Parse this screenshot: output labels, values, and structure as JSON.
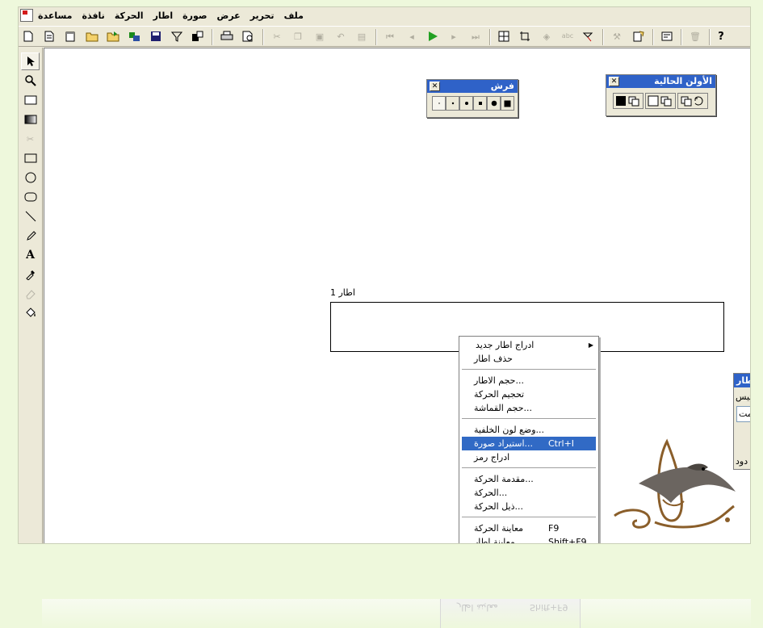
{
  "menubar": {
    "items": [
      "ملف",
      "تحرير",
      "عرض",
      "صورة",
      "اطار",
      "الحركة",
      "نافذة",
      "مساعدة"
    ]
  },
  "toolbar": {
    "buttons": [
      {
        "icon": "new-icon"
      },
      {
        "icon": "new-template-icon"
      },
      {
        "icon": "new-blank-icon"
      },
      {
        "icon": "open-icon"
      },
      {
        "icon": "open-folder-icon"
      },
      {
        "icon": "import-icon"
      },
      {
        "icon": "save-icon"
      },
      {
        "icon": "filter-icon"
      },
      {
        "icon": "export-icon"
      },
      {
        "icon": "print-icon"
      },
      {
        "icon": "print-preview-icon"
      },
      {
        "icon": "cut-icon"
      },
      {
        "icon": "copy-icon"
      },
      {
        "icon": "paste-icon"
      },
      {
        "icon": "undo-icon"
      },
      {
        "icon": "frame-icon"
      },
      {
        "icon": "first-frame-icon"
      },
      {
        "icon": "prev-frame-icon"
      },
      {
        "icon": "play-icon"
      },
      {
        "icon": "next-frame-icon"
      },
      {
        "icon": "last-frame-icon"
      },
      {
        "icon": "grid-icon"
      },
      {
        "icon": "crop-icon"
      },
      {
        "icon": "layers-icon"
      },
      {
        "icon": "text-effect-icon"
      },
      {
        "icon": "pointer-effect-icon"
      },
      {
        "icon": "tools-icon"
      },
      {
        "icon": "new-page-icon"
      },
      {
        "icon": "settings-icon"
      },
      {
        "icon": "delete-icon"
      },
      {
        "icon": "help-icon"
      }
    ]
  },
  "tools": [
    {
      "icon": "select-arrow-icon"
    },
    {
      "icon": "zoom-icon"
    },
    {
      "icon": "rectangle-select-icon"
    },
    {
      "icon": "gradient-icon"
    },
    {
      "icon": "scissors-icon"
    },
    {
      "icon": "rectangle-icon"
    },
    {
      "icon": "ellipse-icon"
    },
    {
      "icon": "rounded-rect-icon"
    },
    {
      "icon": "line-icon"
    },
    {
      "icon": "pencil-icon"
    },
    {
      "icon": "text-icon"
    },
    {
      "icon": "eyedropper-icon"
    },
    {
      "icon": "eraser-icon"
    },
    {
      "icon": "fill-bucket-icon"
    }
  ],
  "brush_palette": {
    "title": "فرش",
    "close": "✕"
  },
  "color_palette": {
    "title": "الأولن الحالية",
    "close": "✕"
  },
  "frame": {
    "label": "اطار 1"
  },
  "side_panel": {
    "title": "اطار",
    "t1": "تيس",
    "field": "مت",
    "t2": "دود"
  },
  "context_menu": {
    "items": [
      {
        "label": "ادراج اطار جديد",
        "submenu": true
      },
      {
        "label": "حذف اطار"
      },
      {
        "sep": true
      },
      {
        "label": "حجم الاطار..."
      },
      {
        "label": "تحجيم الحركة"
      },
      {
        "label": "حجم القماشة..."
      },
      {
        "sep": true
      },
      {
        "label": "وضع لون الخلفية..."
      },
      {
        "label": "استيراد صورة...",
        "shortcut": "Ctrl+I",
        "highlighted": true
      },
      {
        "label": "ادراج رمز"
      },
      {
        "sep": true
      },
      {
        "label": "مقدمة الحركة..."
      },
      {
        "label": "الحركة..."
      },
      {
        "label": "ذيل الحركة..."
      },
      {
        "sep": true
      },
      {
        "label": "معاينة الحركة",
        "shortcut": "F9"
      },
      {
        "label": "معاينة اطار",
        "shortcut": "Shift+F9"
      }
    ]
  },
  "reflection": {
    "label": "معاينة اطار",
    "shortcut": "Shift+F9"
  },
  "colors": {
    "accent": "#316ac5",
    "titlebar": "#2f62c8",
    "play": "#22a022",
    "background": "#eef8dc"
  }
}
